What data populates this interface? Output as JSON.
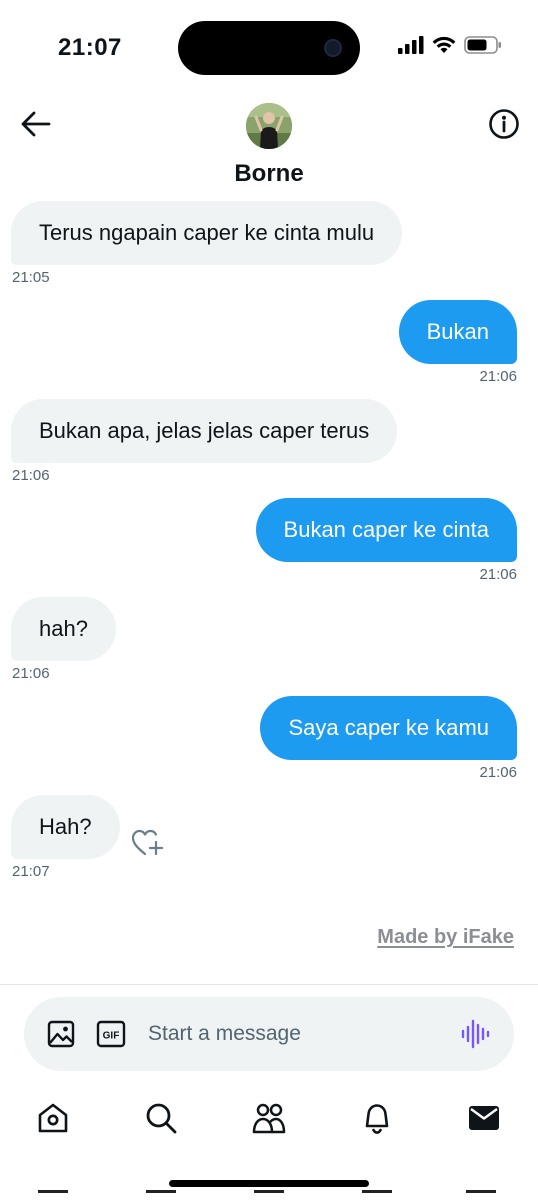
{
  "status_bar": {
    "time": "21:07"
  },
  "header": {
    "contact_name": "Borne"
  },
  "messages": [
    {
      "text": "Terus ngapain caper ke cinta mulu",
      "time": "21:05",
      "direction": "in"
    },
    {
      "text": "Bukan",
      "time": "21:06",
      "direction": "out"
    },
    {
      "text": "Bukan apa, jelas jelas caper terus",
      "time": "21:06",
      "direction": "in"
    },
    {
      "text": "Bukan caper ke cinta",
      "time": "21:06",
      "direction": "out"
    },
    {
      "text": "hah?",
      "time": "21:06",
      "direction": "in"
    },
    {
      "text": "Saya caper ke kamu",
      "time": "21:06",
      "direction": "out"
    },
    {
      "text": "Hah?",
      "time": "21:07",
      "direction": "in"
    }
  ],
  "watermark": "Made by iFake",
  "composer": {
    "placeholder": "Start a message",
    "gif_label": "GIF"
  },
  "colors": {
    "accent": "#1d9bf0",
    "incoming_bubble": "#eff3f4",
    "voice_icon": "#7856ff"
  },
  "icons": {
    "back": "arrow-left-icon",
    "info": "info-icon",
    "react": "heart-add-icon",
    "image": "image-icon",
    "gif": "gif-icon",
    "voice": "voice-waveform-icon",
    "nav": [
      "home-icon",
      "search-icon",
      "communities-icon",
      "notifications-icon",
      "messages-icon"
    ]
  }
}
